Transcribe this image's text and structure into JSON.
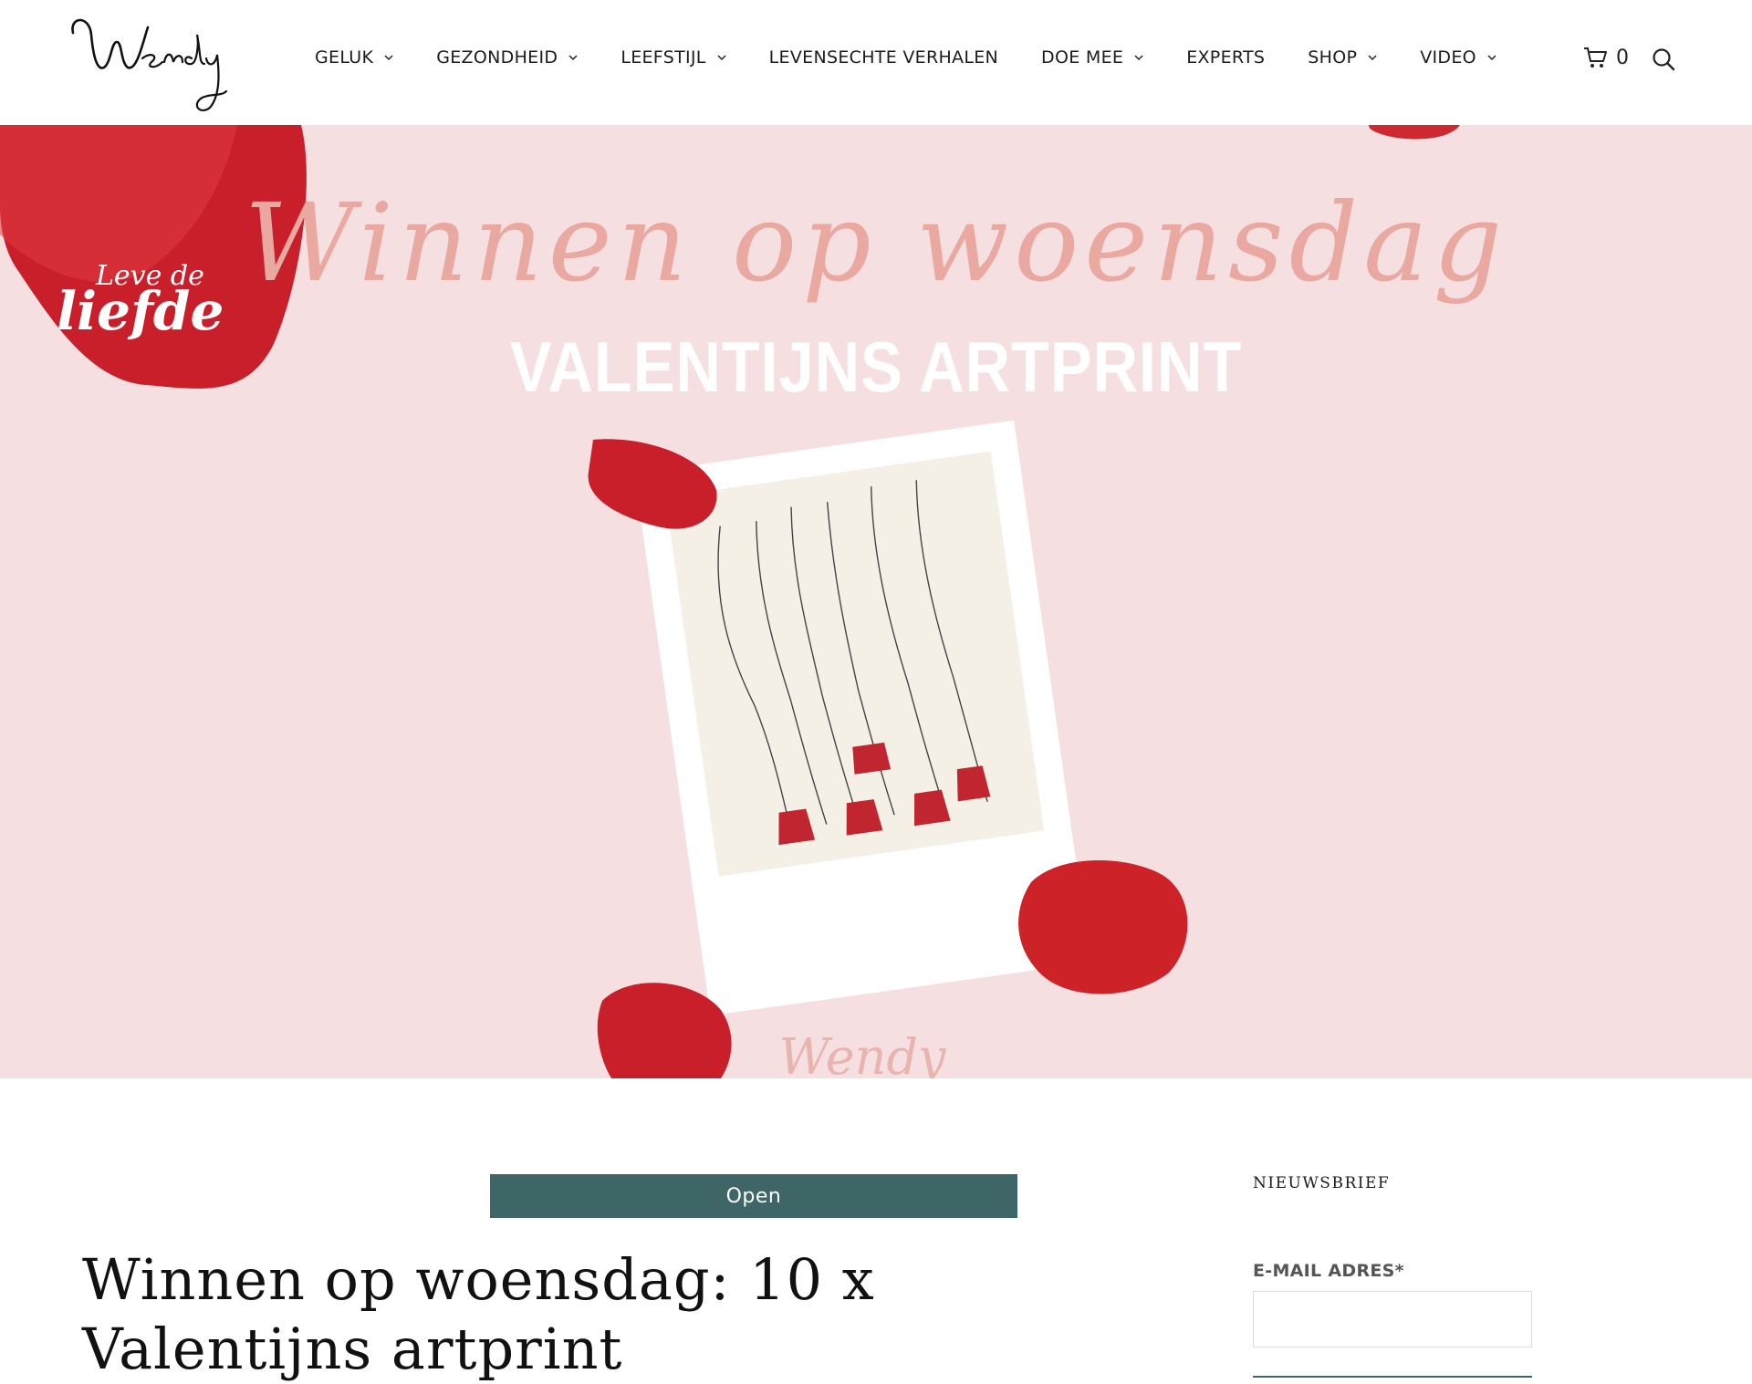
{
  "site": {
    "logo_text": "Wendy"
  },
  "nav": {
    "items": [
      {
        "label": "GELUK",
        "has_dropdown": true
      },
      {
        "label": "GEZONDHEID",
        "has_dropdown": true
      },
      {
        "label": "LEEFSTIJL",
        "has_dropdown": true
      },
      {
        "label": "LEVENSECHTE VERHALEN",
        "has_dropdown": false
      },
      {
        "label": "DOE MEE",
        "has_dropdown": true
      },
      {
        "label": "EXPERTS",
        "has_dropdown": false
      },
      {
        "label": "SHOP",
        "has_dropdown": true
      },
      {
        "label": "VIDEO",
        "has_dropdown": true
      }
    ],
    "cart_count": "0",
    "cart_icon": "cart-icon",
    "search_icon": "search-icon"
  },
  "hero": {
    "badge_small": "Leve de",
    "badge_large": "liefde",
    "script_title": "Winnen op woensdag",
    "main_title": "VALENTIJNS ARTPRINT",
    "watermark": "Wendy",
    "colors": {
      "background": "#f5dfe1",
      "script": "#e9a8a0",
      "petal": "#d42a2e"
    }
  },
  "article": {
    "category_label": "Open",
    "title": "Winnen op woensdag: 10 x Valentijns artprint"
  },
  "sidebar": {
    "heading": "NIEUWSBRIEF",
    "email_label": "E-MAIL ADRES*",
    "email_value": ""
  },
  "colors": {
    "accent": "#3e6666"
  }
}
